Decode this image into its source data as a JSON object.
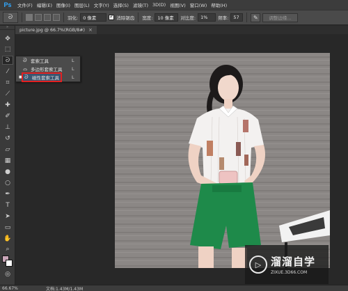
{
  "app": {
    "logo": "Ps"
  },
  "menu": [
    "文件(F)",
    "编辑(E)",
    "图像(I)",
    "图层(L)",
    "文字(Y)",
    "选择(S)",
    "滤镜(T)",
    "3D(D)",
    "视图(V)",
    "窗口(W)",
    "帮助(H)"
  ],
  "options": {
    "feather_label": "羽化:",
    "feather_value": "0 像素",
    "antialias_label": "消除锯齿",
    "width_label": "宽度:",
    "width_value": "10 像素",
    "contrast_label": "对比度:",
    "contrast_value": "1%",
    "frequency_label": "频率:",
    "frequency_value": "57",
    "refine_edge": "调整边缘..."
  },
  "document": {
    "tab_title": "picture.jpg @ 66.7%(RGB/8#)",
    "close": "×"
  },
  "flyout": {
    "items": [
      {
        "label": "套索工具",
        "key": "L"
      },
      {
        "label": "多边形套索工具",
        "key": "L"
      },
      {
        "label": "磁性套索工具",
        "key": "L"
      }
    ]
  },
  "colors": {
    "foreground": "#c9a6b8",
    "background": "#ffffff"
  },
  "status": {
    "zoom": "66.67%",
    "doc": "文档:1.43M/1.43M"
  },
  "watermark": {
    "brand": "溜溜自学",
    "site": "ZIXUE.3D66.COM"
  }
}
